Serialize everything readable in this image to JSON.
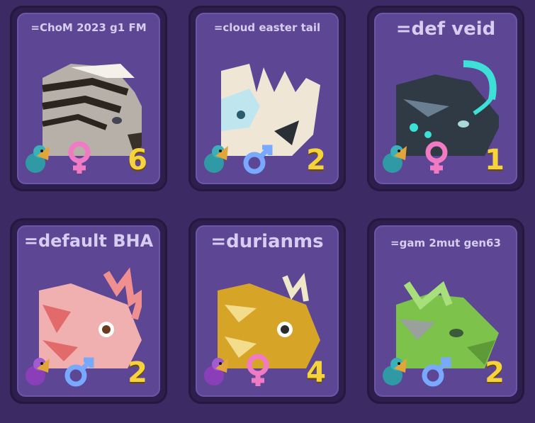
{
  "cards": [
    {
      "name": "=ChoM 2023 g1 FM",
      "count": "6",
      "gender": "female",
      "species_icon": "teal-dragon-icon",
      "accent": "#b7b0a8"
    },
    {
      "name": "=cloud easter tail",
      "count": "2",
      "gender": "male",
      "species_icon": "teal-dragon-icon",
      "accent": "#efe6d6"
    },
    {
      "name": "=def veid",
      "count": "1",
      "gender": "female",
      "species_icon": "teal-dragon-icon",
      "accent": "#2f3a44"
    },
    {
      "name": "=default BHA",
      "count": "2",
      "gender": "male",
      "species_icon": "purple-dragon-icon",
      "accent": "#ef8f8f"
    },
    {
      "name": "=durianms",
      "count": "4",
      "gender": "female",
      "species_icon": "purple-dragon-icon",
      "accent": "#d6a528"
    },
    {
      "name": "=gam 2mut gen63",
      "count": "2",
      "gender": "male",
      "species_icon": "teal-dragon-icon",
      "accent": "#7dc34b"
    }
  ]
}
